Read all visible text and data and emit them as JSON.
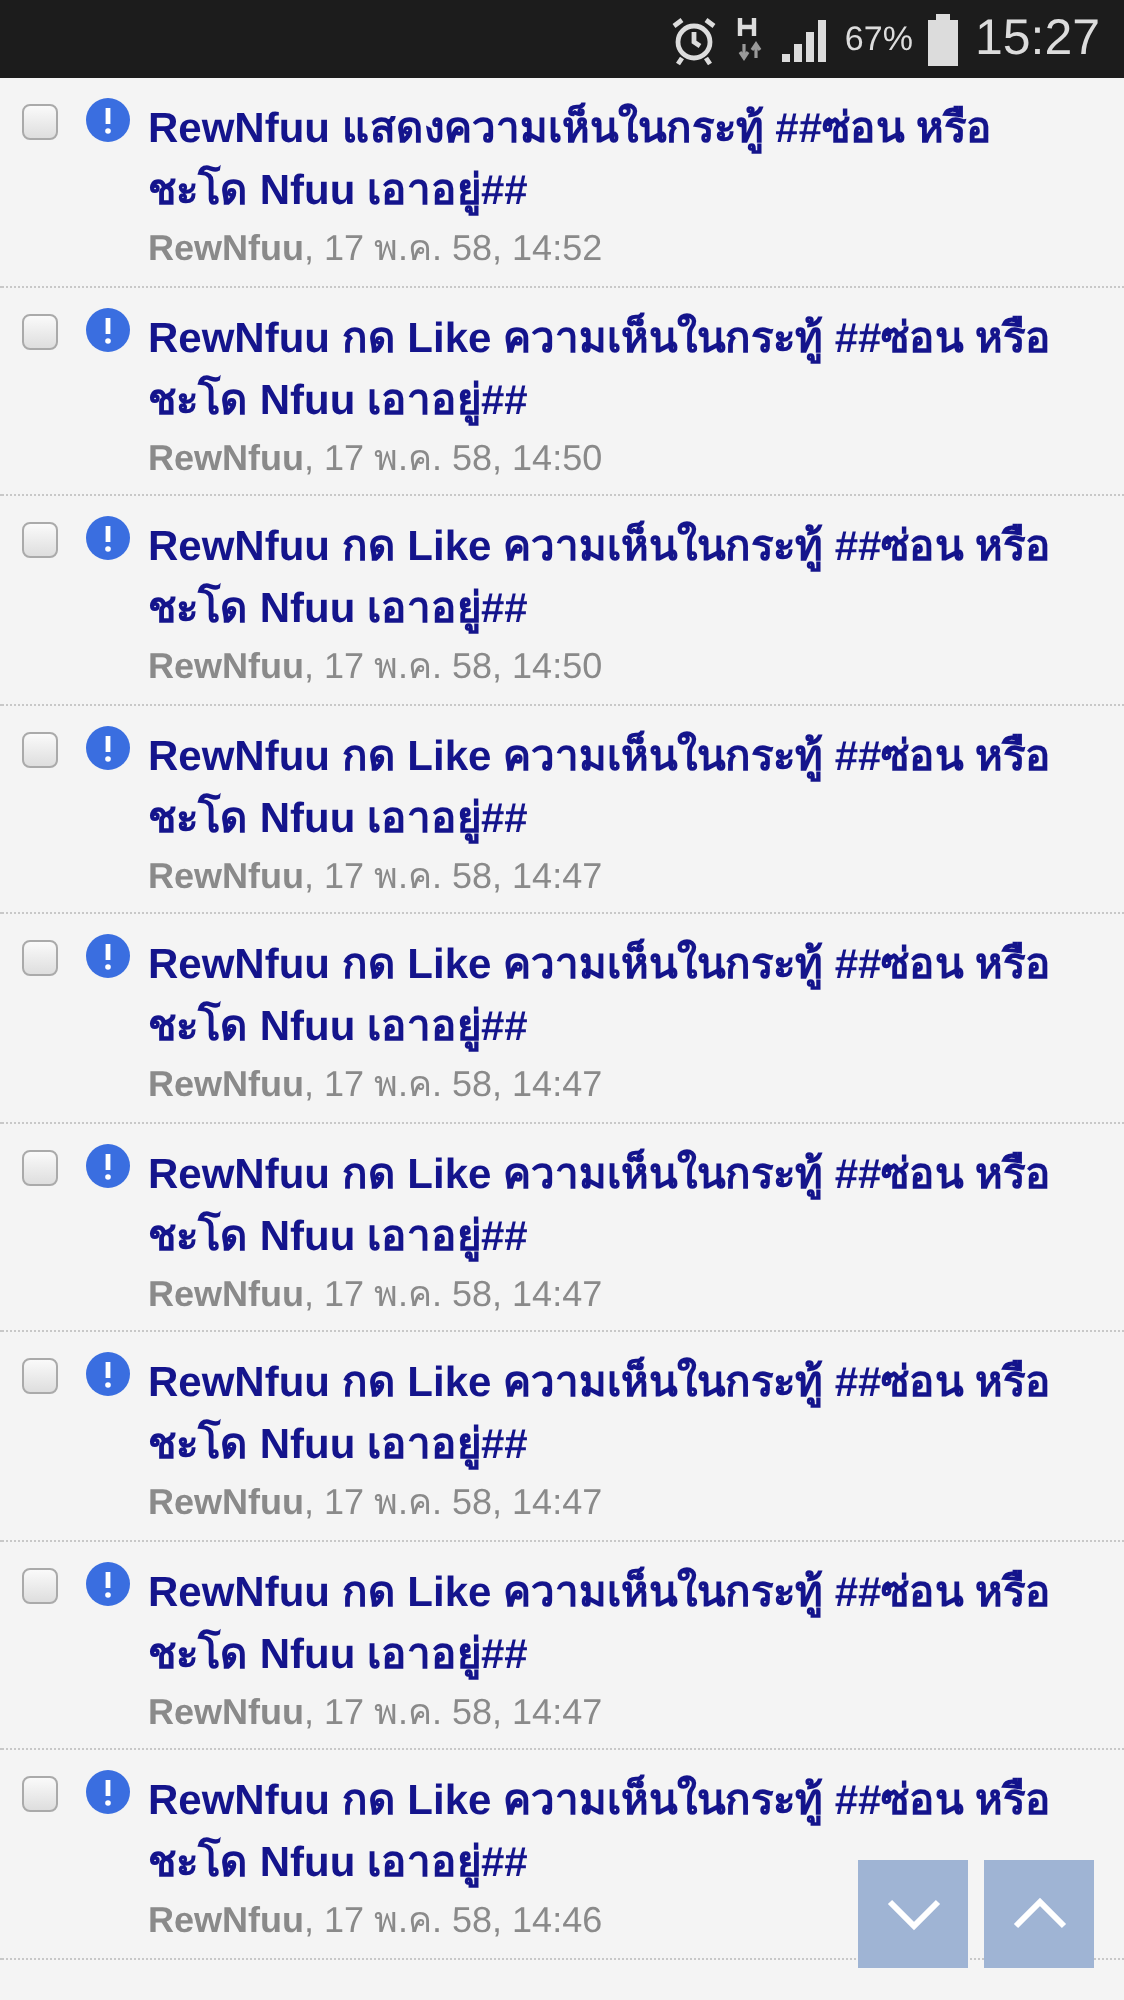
{
  "status_bar": {
    "battery": "67%",
    "time": "15:27"
  },
  "notifications": [
    {
      "title": "RewNfuu แสดงความเห็นในกระทู้ ##ซ่อน หรือ ชะโด Nfuu เอาอยู่##",
      "user": "RewNfuu",
      "date": ", 17 พ.ค. 58, 14:52",
      "checked": false
    },
    {
      "title": "RewNfuu กด Like ความเห็นในกระทู้ ##ซ่อน หรือ ชะโด Nfuu เอาอยู่##",
      "user": "RewNfuu",
      "date": ", 17 พ.ค. 58, 14:50",
      "checked": false
    },
    {
      "title": "RewNfuu กด Like ความเห็นในกระทู้ ##ซ่อน หรือ ชะโด Nfuu เอาอยู่##",
      "user": "RewNfuu",
      "date": ", 17 พ.ค. 58, 14:50",
      "checked": false
    },
    {
      "title": "RewNfuu กด Like ความเห็นในกระทู้ ##ซ่อน หรือ ชะโด Nfuu เอาอยู่##",
      "user": "RewNfuu",
      "date": ", 17 พ.ค. 58, 14:47",
      "checked": false
    },
    {
      "title": "RewNfuu กด Like ความเห็นในกระทู้ ##ซ่อน หรือ ชะโด Nfuu เอาอยู่##",
      "user": "RewNfuu",
      "date": ", 17 พ.ค. 58, 14:47",
      "checked": false
    },
    {
      "title": "RewNfuu กด Like ความเห็นในกระทู้ ##ซ่อน หรือ ชะโด Nfuu เอาอยู่##",
      "user": "RewNfuu",
      "date": ", 17 พ.ค. 58, 14:47",
      "checked": false
    },
    {
      "title": "RewNfuu กด Like ความเห็นในกระทู้ ##ซ่อน หรือ ชะโด Nfuu เอาอยู่##",
      "user": "RewNfuu",
      "date": ", 17 พ.ค. 58, 14:47",
      "checked": false
    },
    {
      "title": "RewNfuu กด Like ความเห็นในกระทู้ ##ซ่อน หรือ ชะโด Nfuu เอาอยู่##",
      "user": "RewNfuu",
      "date": ", 17 พ.ค. 58, 14:47",
      "checked": false
    },
    {
      "title": "RewNfuu กด Like ความเห็นในกระทู้ ##ซ่อน หรือ ชะโด Nfuu เอาอยู่##",
      "user": "RewNfuu",
      "date": ", 17 พ.ค. 58, 14:46",
      "checked": false
    }
  ]
}
